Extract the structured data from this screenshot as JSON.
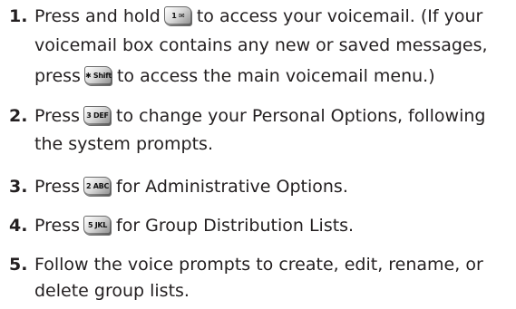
{
  "steps": [
    {
      "number": "1.",
      "lines": [
        [
          "Press and hold",
          {
            "key": "1 ✉"
          },
          "to access your voicemail. (If your"
        ],
        [
          "voicemail box contains any new or saved messages,"
        ],
        [
          "press",
          {
            "key": "✱ Shift"
          },
          "to access the main voicemail menu.)"
        ]
      ]
    },
    {
      "number": "2.",
      "lines": [
        [
          "Press",
          {
            "key": "3 DEF"
          },
          "to change your Personal Options, following"
        ],
        [
          "the system prompts."
        ]
      ]
    },
    {
      "number": "3.",
      "lines": [
        [
          "Press",
          {
            "key": "2 ABC"
          },
          "for Administrative Options."
        ]
      ]
    },
    {
      "number": "4.",
      "lines": [
        [
          "Press",
          {
            "key": "5 JKL"
          },
          "for Group Distribution Lists."
        ]
      ]
    },
    {
      "number": "5.",
      "lines": [
        [
          "Follow the voice prompts to create, edit, rename, or"
        ],
        [
          "delete group lists."
        ]
      ]
    }
  ]
}
